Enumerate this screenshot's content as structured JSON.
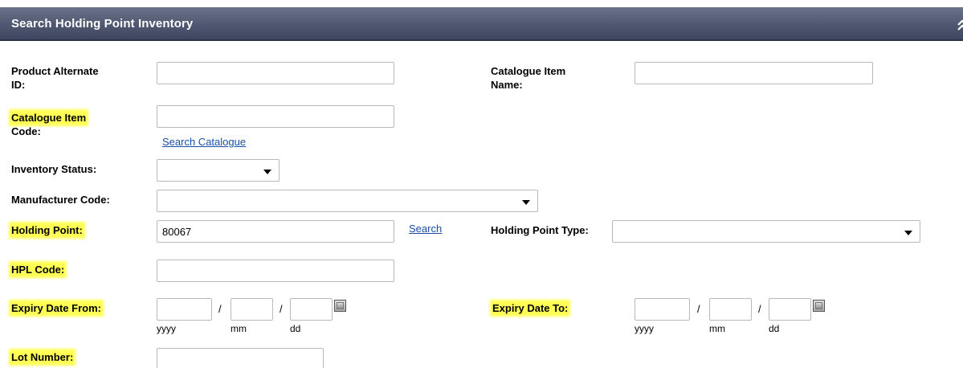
{
  "header": {
    "title": "Search Holding Point Inventory",
    "collapse_icon": "double-chevron-up-icon"
  },
  "highlight_color": "#ffff55",
  "header_color": "#4f5870",
  "link_color": "#1a4fa8",
  "form": {
    "product_alt_id": {
      "label_line1": "Product Alternate",
      "label_line2": "ID:",
      "value": ""
    },
    "catalogue_item_name": {
      "label_line1": "Catalogue Item",
      "label_line2": "Name:",
      "value": ""
    },
    "catalogue_item_code": {
      "label_line1": "Catalogue Item",
      "label_line2": "Code:",
      "value": "",
      "search_link": "Search Catalogue"
    },
    "inventory_status": {
      "label": "Inventory Status:",
      "selected": ""
    },
    "manufacturer_code": {
      "label": "Manufacturer Code:",
      "selected": ""
    },
    "holding_point": {
      "label": "Holding Point:",
      "value": "80067",
      "search_link": "Search"
    },
    "holding_point_type": {
      "label": "Holding Point Type:",
      "selected": ""
    },
    "hpl_code": {
      "label": "HPL Code:",
      "value": ""
    },
    "expiry_date_from": {
      "label": "Expiry Date From:",
      "yyyy": "",
      "mm": "",
      "dd": "",
      "sep": "/",
      "sub_yyyy": "yyyy",
      "sub_mm": "mm",
      "sub_dd": "dd"
    },
    "expiry_date_to": {
      "label": "Expiry Date To:",
      "yyyy": "",
      "mm": "",
      "dd": "",
      "sep": "/",
      "sub_yyyy": "yyyy",
      "sub_mm": "mm",
      "sub_dd": "dd"
    },
    "lot_number": {
      "label": "Lot Number:",
      "value": ""
    }
  }
}
